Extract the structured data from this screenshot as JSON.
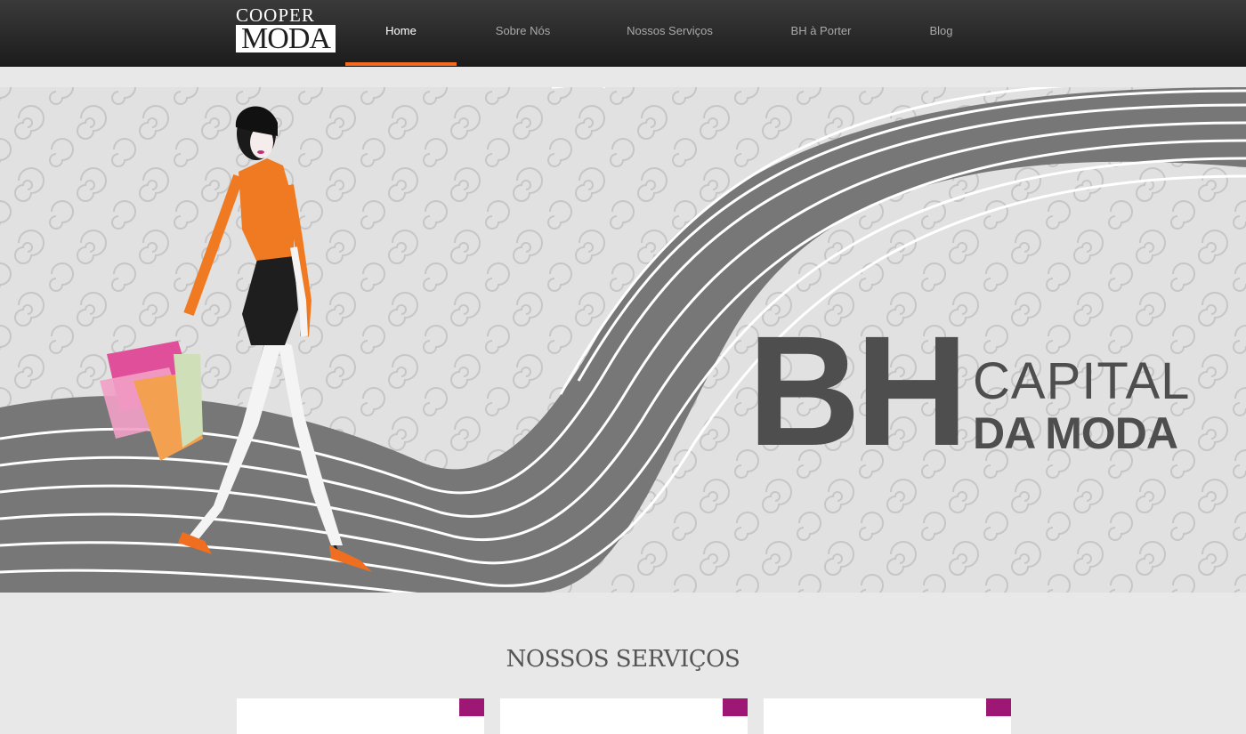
{
  "brand": {
    "logo_top": "COOPER",
    "logo_bottom": "MODA",
    "accent_color": "#f26b1f",
    "card_accent_color": "#9e1774"
  },
  "nav": {
    "items": [
      {
        "label": "Home",
        "active": true
      },
      {
        "label": "Sobre Nós",
        "active": false
      },
      {
        "label": "Nossos Serviços",
        "active": false
      },
      {
        "label": "BH à Porter",
        "active": false
      },
      {
        "label": "Blog",
        "active": false
      }
    ]
  },
  "hero": {
    "headline_big": "BH",
    "headline_line1": "CAPITAL",
    "headline_line2": "DA MODA"
  },
  "services": {
    "title": "NOSSOS SERVIÇOS",
    "cards": [
      {},
      {},
      {}
    ]
  }
}
